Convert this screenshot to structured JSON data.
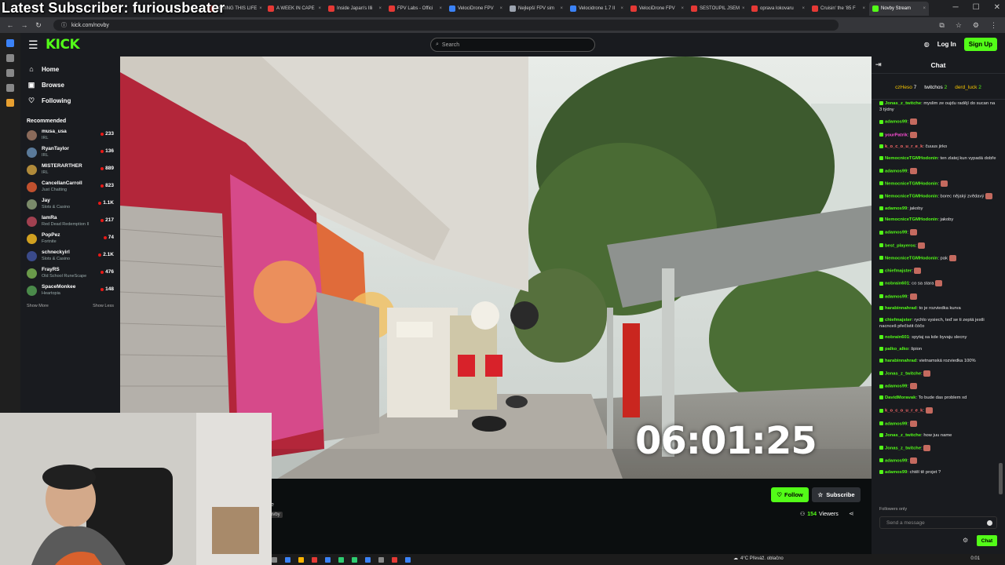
{
  "overlay": {
    "text": "Latest Subscriber: furiousbeater"
  },
  "browser": {
    "tabs": [
      {
        "label": "LOVING THIS LIFE",
        "color": "#e53935"
      },
      {
        "label": "A WEEK IN CAPE",
        "color": "#e53935"
      },
      {
        "label": "Inside Japan's Illi",
        "color": "#e53935"
      },
      {
        "label": "FPV Labs - Offici",
        "color": "#e53935"
      },
      {
        "label": "VelociDrone FPV",
        "color": "#3b82f6"
      },
      {
        "label": "Nejlepší FPV sim",
        "color": "#9ca3af"
      },
      {
        "label": "Velocidrone 1.7 II",
        "color": "#3b82f6"
      },
      {
        "label": "VelociDrone FPV",
        "color": "#e53935"
      },
      {
        "label": "SESTOUPIL JSEM",
        "color": "#e53935"
      },
      {
        "label": "oprava lokovaru",
        "color": "#e53935"
      },
      {
        "label": "Cruisin' the '85 F",
        "color": "#e53935"
      },
      {
        "label": "Novby Stream",
        "color": "#53fc18",
        "active": true
      }
    ],
    "url": "kick.com/novby"
  },
  "header": {
    "logo": "KICK",
    "search_placeholder": "Search",
    "login": "Log In",
    "signup": "Sign Up"
  },
  "sidebar": {
    "nav": [
      {
        "label": "Home",
        "icon": "home-icon"
      },
      {
        "label": "Browse",
        "icon": "browse-icon"
      },
      {
        "label": "Following",
        "icon": "heart-icon"
      }
    ],
    "recommended_title": "Recommended",
    "channels": [
      {
        "name": "musa_usa",
        "category": "IRL",
        "viewers": "233",
        "color": "#8a6a5a"
      },
      {
        "name": "RyanTaylor",
        "category": "IRL",
        "viewers": "136",
        "color": "#5a7a9a"
      },
      {
        "name": "MISTERARTHER",
        "category": "IRL",
        "viewers": "889",
        "color": "#b08a3a"
      },
      {
        "name": "CancellanCarroll",
        "category": "Just Chatting",
        "viewers": "823",
        "color": "#c0502e"
      },
      {
        "name": "Jay",
        "category": "Slots & Casino",
        "viewers": "1.1K",
        "color": "#7a8a6a"
      },
      {
        "name": "IamRa",
        "category": "Red Dead Redemption II",
        "viewers": "217",
        "color": "#a04050"
      },
      {
        "name": "PopPez",
        "category": "Fortnite",
        "viewers": "74",
        "color": "#d0a020"
      },
      {
        "name": "schneckyirl",
        "category": "Slots & Casino",
        "viewers": "2.1K",
        "color": "#3a4a8a"
      },
      {
        "name": "FrayRS",
        "category": "Old School RuneScape",
        "viewers": "476",
        "color": "#6a9a4a"
      },
      {
        "name": "SpaceMonkee",
        "category": "Heartopia",
        "viewers": "148",
        "color": "#4a8a4a"
      }
    ],
    "show_more": "Show More",
    "show_less": "Show Less"
  },
  "player": {
    "timer": "06:01:25"
  },
  "channel": {
    "name_fragment": "e",
    "handle_fragment": "ovby",
    "follow": "Follow",
    "subscribe": "Subscribe",
    "viewers_count": "154",
    "viewers_label": "Viewers"
  },
  "chat": {
    "title": "Chat",
    "pinned": [
      {
        "name": "czHeso",
        "value": "7",
        "color": "#f5c400"
      },
      {
        "name": "twitchos",
        "value": "2",
        "color": "#ffffff"
      },
      {
        "name": "derd_luck",
        "value": "2",
        "color": "#f5c400"
      }
    ],
    "messages": [
      {
        "user": "Jonas_z_twitche",
        "color": "#53fc18",
        "text": "myslim ze oujdu radějí do sucan na 3 týdny"
      },
      {
        "user": "adamos99",
        "color": "#53fc18",
        "text": "",
        "emote": true
      },
      {
        "user": "yourPatrik",
        "color": "#ff4fd8",
        "text": "",
        "emote": true
      },
      {
        "user": "k_o_c_o_u_r_e_k",
        "color": "#ff6b6b",
        "text": "čuuus jirko"
      },
      {
        "user": "NemocniceTGMHodonin",
        "color": "#53fc18",
        "text": "ten zlatej kun vypadá dobře"
      },
      {
        "user": "adamos99",
        "color": "#53fc18",
        "text": "",
        "emote": true
      },
      {
        "user": "NemocniceTGMHodonin",
        "color": "#53fc18",
        "text": "",
        "emote": true
      },
      {
        "user": "NemocniceTGMHodonin",
        "color": "#53fc18",
        "text": "borec nějaký zvědavý",
        "emote": true
      },
      {
        "user": "adamos99",
        "color": "#53fc18",
        "text": "jakoby"
      },
      {
        "user": "NemocniceTGMHodonin",
        "color": "#53fc18",
        "text": "jakoby"
      },
      {
        "user": "adamos99",
        "color": "#53fc18",
        "text": "",
        "emote": true
      },
      {
        "user": "best_playeros",
        "color": "#53fc18",
        "text": "",
        "emote": true
      },
      {
        "user": "NemocniceTGMHodonin",
        "color": "#53fc18",
        "text": "pak",
        "emote": true
      },
      {
        "user": "chiefmajster",
        "color": "#53fc18",
        "text": "",
        "emote": true
      },
      {
        "user": "nobrain601",
        "color": "#53fc18",
        "text": "co sa stara",
        "emote": true
      },
      {
        "user": "adamos99",
        "color": "#53fc18",
        "text": "",
        "emote": true
      },
      {
        "user": "harabinnahrad",
        "color": "#53fc18",
        "text": "to je rozviedka kurva"
      },
      {
        "user": "chiefmajster",
        "color": "#53fc18",
        "text": "rychlo vysiech, teď se ti zeptá jestli nacnceš přečístit čóčo"
      },
      {
        "user": "nobrain601",
        "color": "#53fc18",
        "text": "spytaj sa kde byvaju slecny"
      },
      {
        "user": "palko_alko",
        "color": "#53fc18",
        "text": "špion"
      },
      {
        "user": "harabinnahrad",
        "color": "#53fc18",
        "text": "vietnamská rozviedka 100%"
      },
      {
        "user": "Jonas_z_twitche",
        "color": "#53fc18",
        "text": "",
        "emote": true
      },
      {
        "user": "adamos99",
        "color": "#53fc18",
        "text": "",
        "emote": true
      },
      {
        "user": "DavidMoravak",
        "color": "#53fc18",
        "text": "To bude das problem xd"
      },
      {
        "user": "k_o_c_o_u_r_e_k",
        "color": "#ff6b6b",
        "text": "",
        "emote": true
      },
      {
        "user": "adamos99",
        "color": "#53fc18",
        "text": "",
        "emote": true
      },
      {
        "user": "Jonas_z_twitche",
        "color": "#53fc18",
        "text": "how juu name"
      },
      {
        "user": "Jonas_z_twitche",
        "color": "#53fc18",
        "text": "",
        "emote": true
      },
      {
        "user": "adamos99",
        "color": "#53fc18",
        "text": "",
        "emote": true
      },
      {
        "user": "adamos99",
        "color": "#53fc18",
        "text": "chtěl tě projet ?"
      }
    ],
    "followers_only": "Followers only",
    "input_placeholder": "Send a message",
    "send": "Chat"
  },
  "taskbar": {
    "weather": "4°C  Převáž. oblačno",
    "time": "0:01"
  },
  "colors": {
    "accent": "#53fc18",
    "bg": "#0b0e0f",
    "panel": "#191b1f"
  }
}
